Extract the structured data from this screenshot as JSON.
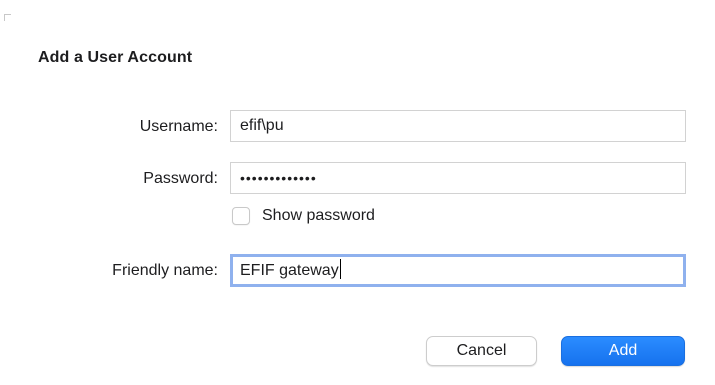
{
  "dialog": {
    "title": "Add a User Account"
  },
  "form": {
    "username": {
      "label": "Username:",
      "value": "efif\\pu"
    },
    "password": {
      "label": "Password:",
      "value": "•••••••••••••"
    },
    "show_password": {
      "label": "Show password",
      "checked": false
    },
    "friendly_name": {
      "label": "Friendly name:",
      "value": "EFIF gateway"
    }
  },
  "buttons": {
    "cancel": "Cancel",
    "add": "Add"
  },
  "colors": {
    "accent": "#1672ee",
    "focus_ring": "#8fb1ee"
  }
}
